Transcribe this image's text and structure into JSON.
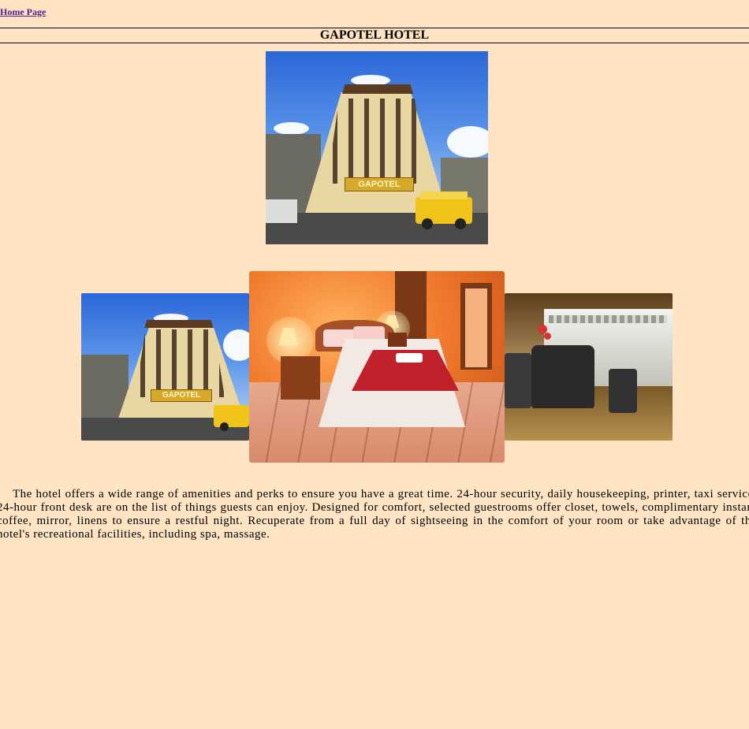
{
  "nav": {
    "home_label": "Home Page"
  },
  "header": {
    "title": "GAPOTEL HOTEL"
  },
  "photos": {
    "main_sign": "GAPOTEL",
    "left_sign": "GAPOTEL"
  },
  "description": "The hotel offers a wide range of amenities and perks to ensure you have a great time. 24-hour security, daily housekeeping, printer, taxi service, 24-hour front desk are on the list of things guests can enjoy. Designed for comfort, selected guestrooms offer closet, towels, complimentary instant coffee, mirror, linens to ensure a restful night. Recuperate from a full day of sightseeing in the comfort of your room or take advantage of the hotel's recreational facilities, including spa, massage.",
  "colors": {
    "background": "#ffe4c4",
    "link": "#551a8b"
  }
}
